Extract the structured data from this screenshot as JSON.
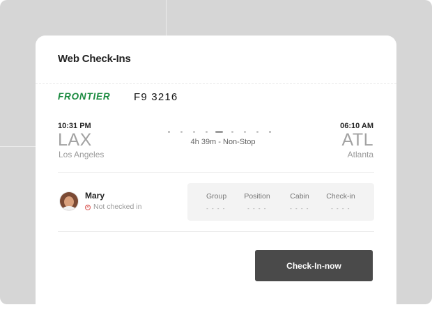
{
  "panel": {
    "title": "Web Check-Ins"
  },
  "flight": {
    "airline": "FRONTIER",
    "number": "F9 3216",
    "departure": {
      "time": "10:31 PM",
      "code": "LAX",
      "city": "Los Angeles"
    },
    "arrival": {
      "time": "06:10 AM",
      "code": "ATL",
      "city": "Atlanta"
    },
    "duration": "4h 39m - Non-Stop"
  },
  "passenger": {
    "name": "Mary",
    "status": "Not checked in",
    "status_color": "#d9534f",
    "columns": [
      {
        "label": "Group",
        "value": "- - - -"
      },
      {
        "label": "Position",
        "value": "- - - -"
      },
      {
        "label": "Cabin",
        "value": "- - - -"
      },
      {
        "label": "Check-in",
        "value": "- - - -"
      }
    ]
  },
  "actions": {
    "checkin_label": "Check-In-now"
  },
  "colors": {
    "brand": "#1a8a3f",
    "button_bg": "#4a4a4a",
    "backdrop": "#d6d6d6"
  }
}
